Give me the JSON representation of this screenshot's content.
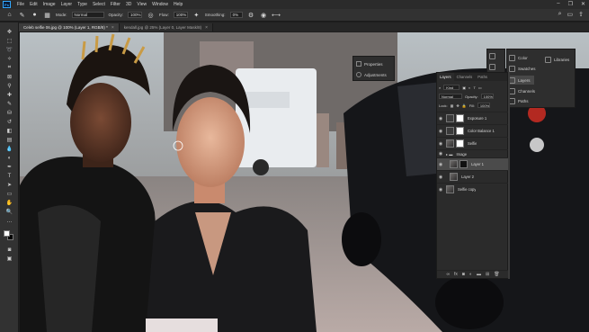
{
  "menubar": {
    "logo": "Ps",
    "items": [
      "File",
      "Edit",
      "Image",
      "Layer",
      "Type",
      "Select",
      "Filter",
      "3D",
      "View",
      "Window",
      "Help"
    ],
    "controls": [
      "–",
      "❐",
      "✕"
    ]
  },
  "options": {
    "mode_label": "Mode:",
    "mode_value": "Normal",
    "opacity_label": "Opacity:",
    "opacity_value": "100%",
    "flow_label": "Flow:",
    "flow_value": "100%",
    "smoothing_label": "Smoothing:",
    "smoothing_value": "0%"
  },
  "tabs": [
    {
      "label": "Celeb selfie 06.jpg @ 100% (Layer 1, RGB/8) *",
      "active": true
    },
    {
      "label": "kendall.jpg @ 25% (Layer 0, Layer Mask/8)",
      "active": false
    }
  ],
  "dock": {
    "items": [
      {
        "label": "Color",
        "selected": false
      },
      {
        "label": "Swatches",
        "selected": false
      },
      {
        "label": "Layers",
        "selected": true
      },
      {
        "label": "Channels",
        "selected": false
      },
      {
        "label": "Paths",
        "selected": false
      }
    ],
    "libraries": "Libraries"
  },
  "properties": {
    "items": [
      "Properties",
      "Adjustments"
    ]
  },
  "layers_panel": {
    "tabs": [
      "Layers",
      "Channels",
      "Paths"
    ],
    "kind_label": "Kind",
    "blend_mode": "Normal",
    "opacity_label": "Opacity:",
    "opacity_value": "100%",
    "lock_label": "Lock:",
    "fill_label": "Fill:",
    "fill_value": "100%",
    "layers": [
      {
        "name": "Exposure 1",
        "thumb": "adj",
        "selected": false
      },
      {
        "name": "Color Balance 1",
        "thumb": "adj",
        "selected": false
      },
      {
        "name": "Selfie",
        "thumb": "folder",
        "selected": false
      },
      {
        "name": "Image",
        "thumb": "folder",
        "selected": false
      },
      {
        "name": "Layer 1",
        "thumb": "img",
        "selected": true
      },
      {
        "name": "Layer 2",
        "thumb": "img",
        "selected": false
      },
      {
        "name": "Selfie copy",
        "thumb": "folder",
        "selected": false
      }
    ],
    "footer_icons": [
      "link-icon",
      "fx-icon",
      "mask-icon",
      "adjustment-icon",
      "folder-icon",
      "new-layer-icon",
      "trash-icon"
    ]
  },
  "colors": {
    "accent": "#31a8ff",
    "panel": "#2b2b2b",
    "selected_row": "#4b4b4b",
    "foreground_swatch": "#ffffff",
    "background_swatch": "#000000"
  }
}
